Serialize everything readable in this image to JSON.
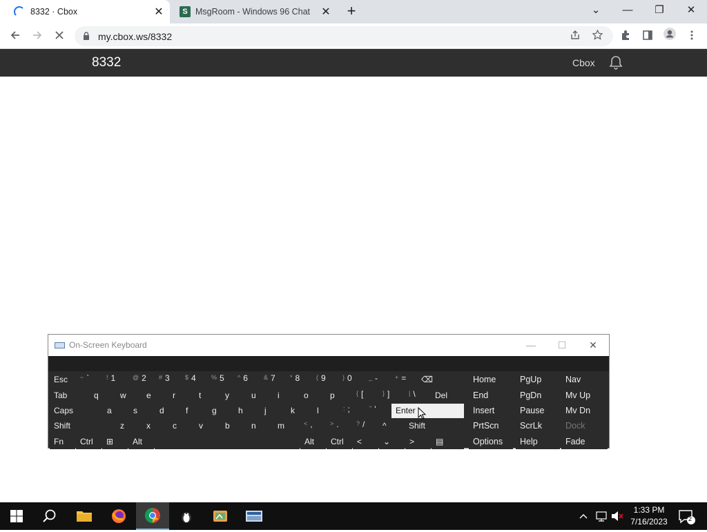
{
  "browser": {
    "tabs": [
      {
        "title": "8332 · Cbox",
        "close": "✕"
      },
      {
        "title": "MsgRoom - Windows 96 Chat",
        "close": "✕",
        "favicon_letter": "S"
      }
    ],
    "new_tab": "+",
    "address": "my.cbox.ws/8332",
    "window_buttons": {
      "dropdown": "⌄",
      "minimize": "—",
      "restore": "❐",
      "close": "✕"
    }
  },
  "page": {
    "room_title": "8332",
    "brand": "Cbox",
    "accent_dark": "#2f2f2f"
  },
  "osk": {
    "title": "On-Screen Keyboard",
    "rows": [
      [
        {
          "l": "Esc"
        },
        {
          "s": "~",
          "l": "`"
        },
        {
          "s": "!",
          "l": "1"
        },
        {
          "s": "@",
          "l": "2"
        },
        {
          "s": "#",
          "l": "3"
        },
        {
          "s": "$",
          "l": "4"
        },
        {
          "s": "%",
          "l": "5"
        },
        {
          "s": "^",
          "l": "6"
        },
        {
          "s": "&",
          "l": "7"
        },
        {
          "s": "*",
          "l": "8"
        },
        {
          "s": "(",
          "l": "9"
        },
        {
          "s": ")",
          "l": "0"
        },
        {
          "s": "_",
          "l": "-"
        },
        {
          "s": "+",
          "l": "="
        },
        {
          "l": "⌫"
        }
      ],
      [
        {
          "l": "Tab"
        },
        {
          "l": "q"
        },
        {
          "l": "w"
        },
        {
          "l": "e"
        },
        {
          "l": "r"
        },
        {
          "l": "t"
        },
        {
          "l": "y"
        },
        {
          "l": "u"
        },
        {
          "l": "i"
        },
        {
          "l": "o"
        },
        {
          "l": "p"
        },
        {
          "s": "{",
          "l": "["
        },
        {
          "s": "}",
          "l": "]"
        },
        {
          "s": "|",
          "l": "\\"
        },
        {
          "l": "Del"
        }
      ],
      [
        {
          "l": "Caps"
        },
        {
          "l": "a"
        },
        {
          "l": "s"
        },
        {
          "l": "d"
        },
        {
          "l": "f"
        },
        {
          "l": "g"
        },
        {
          "l": "h"
        },
        {
          "l": "j"
        },
        {
          "l": "k"
        },
        {
          "l": "l"
        },
        {
          "s": ":",
          "l": ";"
        },
        {
          "s": "\"",
          "l": "'"
        },
        {
          "l": "Enter"
        }
      ],
      [
        {
          "l": "Shift"
        },
        {
          "l": "z"
        },
        {
          "l": "x"
        },
        {
          "l": "c"
        },
        {
          "l": "v"
        },
        {
          "l": "b"
        },
        {
          "l": "n"
        },
        {
          "l": "m"
        },
        {
          "s": "<",
          "l": ","
        },
        {
          "s": ">",
          "l": "."
        },
        {
          "s": "?",
          "l": "/"
        },
        {
          "l": "^"
        },
        {
          "l": "Shift"
        }
      ],
      [
        {
          "l": "Fn"
        },
        {
          "l": "Ctrl"
        },
        {
          "l": "⊞"
        },
        {
          "l": "Alt"
        },
        {
          "l": ""
        },
        {
          "l": "Alt"
        },
        {
          "l": "Ctrl"
        },
        {
          "l": "<"
        },
        {
          "l": "⌄"
        },
        {
          "l": ">"
        },
        {
          "l": "▤"
        }
      ]
    ],
    "nav_keys": [
      [
        "Home",
        "PgUp",
        "Nav"
      ],
      [
        "End",
        "PgDn",
        "Mv Up"
      ],
      [
        "Insert",
        "Pause",
        "Mv Dn"
      ],
      [
        "PrtScn",
        "ScrLk",
        "Dock"
      ],
      [
        "Options",
        "Help",
        "Fade"
      ]
    ]
  },
  "taskbar": {
    "time": "1:33 PM",
    "date": "7/16/2023",
    "notifications": "2"
  }
}
